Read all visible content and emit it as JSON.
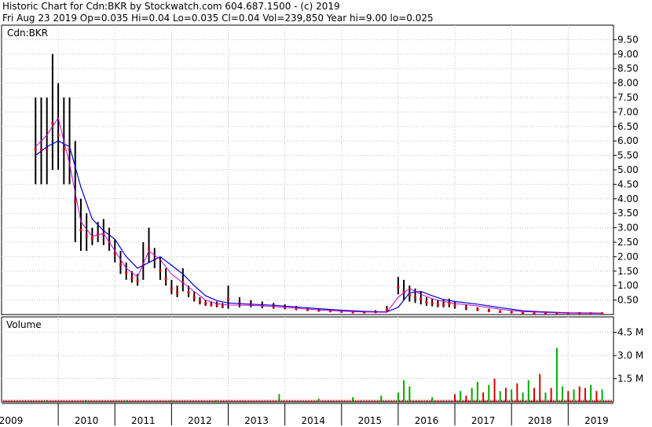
{
  "header": {
    "line1": "Historic Chart for Cdn:BKR by Stockwatch.com 604.687.1500 - (c) 2019",
    "line2": "Fri Aug 23 2019  Op=0.035  Hi=0.04  Lo=0.035  Cl=0.04  Vol=239,850  Year hi=9.00  lo=0.025"
  },
  "colors": {
    "background": "#ffffff",
    "grid": "#c0c0c0",
    "price_bar": "#000000",
    "ma_fast": "#cc00cc",
    "ma_slow": "#0000cc",
    "close_dots": "#dd0000",
    "volume_up": "#00aa00",
    "volume_down": "#dd0000"
  },
  "chart_data": [
    {
      "type": "line",
      "title": "Cdn:BKR",
      "ylim": [
        0,
        10
      ],
      "y_ticks": [
        "9.50",
        "9.00",
        "8.50",
        "8.00",
        "7.50",
        "7.00",
        "6.50",
        "6.00",
        "5.50",
        "5.00",
        "4.50",
        "4.00",
        "3.50",
        "3.00",
        "2.50",
        "2.00",
        "1.50",
        "1.00",
        "0.50"
      ],
      "x_ticks": [
        "2009",
        "2010",
        "2011",
        "2012",
        "2013",
        "2014",
        "2015",
        "2016",
        "2017",
        "2018",
        "2019"
      ],
      "grid": true,
      "series": [
        {
          "style": "hi-lo bars",
          "x": [
            2009.6,
            2009.7,
            2009.8,
            2009.9,
            2010.0,
            2010.1,
            2010.2,
            2010.3,
            2010.4,
            2010.5,
            2010.6,
            2010.7,
            2010.8,
            2010.9,
            2011.0,
            2011.1,
            2011.2,
            2011.3,
            2011.4,
            2011.5,
            2011.6,
            2011.7,
            2011.8,
            2011.9,
            2012.0,
            2012.1,
            2012.2,
            2012.3,
            2012.4,
            2012.5,
            2012.6,
            2012.7,
            2012.8,
            2012.9,
            2013.0,
            2013.2,
            2013.4,
            2013.6,
            2013.8,
            2014.0,
            2014.2,
            2014.4,
            2014.6,
            2014.8,
            2015.0,
            2015.2,
            2015.4,
            2015.6,
            2015.8,
            2016.0,
            2016.1,
            2016.2,
            2016.3,
            2016.4,
            2016.5,
            2016.6,
            2016.7,
            2016.8,
            2016.9,
            2017.0,
            2017.2,
            2017.4,
            2017.6,
            2017.8,
            2018.0,
            2018.2,
            2018.4,
            2018.6,
            2018.8,
            2019.0,
            2019.2,
            2019.4,
            2019.6
          ],
          "high": [
            7.5,
            7.5,
            7.5,
            9.0,
            8.0,
            7.5,
            7.5,
            6.0,
            4.0,
            3.5,
            3.0,
            3.2,
            3.3,
            3.0,
            2.6,
            2.2,
            1.8,
            1.5,
            1.4,
            2.5,
            3.0,
            2.3,
            2.0,
            1.6,
            1.2,
            1.0,
            1.6,
            1.0,
            0.8,
            0.6,
            0.5,
            0.45,
            0.45,
            0.4,
            1.0,
            0.6,
            0.5,
            0.45,
            0.4,
            0.35,
            0.3,
            0.25,
            0.2,
            0.18,
            0.15,
            0.12,
            0.12,
            0.15,
            0.3,
            1.3,
            1.2,
            1.0,
            0.9,
            0.8,
            0.6,
            0.55,
            0.5,
            0.5,
            0.55,
            0.45,
            0.35,
            0.25,
            0.2,
            0.15,
            0.12,
            0.1,
            0.08,
            0.08,
            0.07,
            0.06,
            0.06,
            0.05,
            0.04
          ],
          "low": [
            4.5,
            4.5,
            4.5,
            5.0,
            5.0,
            4.5,
            4.5,
            2.5,
            2.2,
            2.2,
            2.4,
            2.5,
            2.4,
            2.2,
            1.8,
            1.4,
            1.2,
            1.1,
            1.0,
            1.2,
            1.8,
            1.6,
            1.2,
            1.0,
            0.7,
            0.6,
            0.8,
            0.6,
            0.45,
            0.35,
            0.3,
            0.28,
            0.25,
            0.22,
            0.2,
            0.25,
            0.25,
            0.22,
            0.2,
            0.18,
            0.15,
            0.12,
            0.1,
            0.08,
            0.07,
            0.05,
            0.05,
            0.05,
            0.08,
            0.7,
            0.5,
            0.45,
            0.4,
            0.35,
            0.3,
            0.28,
            0.25,
            0.25,
            0.25,
            0.2,
            0.15,
            0.12,
            0.08,
            0.06,
            0.05,
            0.04,
            0.03,
            0.03,
            0.03,
            0.025,
            0.03,
            0.03,
            0.035
          ]
        },
        {
          "style": "moving average (fast)",
          "x": [
            2009.6,
            2009.8,
            2010.0,
            2010.2,
            2010.4,
            2010.6,
            2010.8,
            2011.0,
            2011.2,
            2011.4,
            2011.6,
            2011.8,
            2012.0,
            2012.2,
            2012.4,
            2012.6,
            2012.8,
            2013.0,
            2013.4,
            2013.8,
            2014.2,
            2014.6,
            2015.0,
            2015.4,
            2015.8,
            2016.0,
            2016.2,
            2016.4,
            2016.6,
            2016.8,
            2017.0,
            2017.4,
            2017.8,
            2018.2,
            2018.6,
            2019.0,
            2019.6
          ],
          "y": [
            5.8,
            6.2,
            6.8,
            5.2,
            3.2,
            2.7,
            2.8,
            2.2,
            1.6,
            1.3,
            2.2,
            1.9,
            1.4,
            1.1,
            0.8,
            0.5,
            0.38,
            0.33,
            0.32,
            0.28,
            0.22,
            0.16,
            0.12,
            0.09,
            0.08,
            0.6,
            0.9,
            0.7,
            0.55,
            0.45,
            0.38,
            0.3,
            0.18,
            0.1,
            0.07,
            0.05,
            0.04
          ]
        },
        {
          "style": "moving average (slow)",
          "x": [
            2009.6,
            2009.8,
            2010.0,
            2010.2,
            2010.4,
            2010.6,
            2010.8,
            2011.0,
            2011.2,
            2011.4,
            2011.6,
            2011.8,
            2012.0,
            2012.2,
            2012.4,
            2012.6,
            2012.8,
            2013.0,
            2013.4,
            2013.8,
            2014.2,
            2014.6,
            2015.0,
            2015.4,
            2015.8,
            2016.0,
            2016.2,
            2016.4,
            2016.6,
            2016.8,
            2017.0,
            2017.4,
            2017.8,
            2018.2,
            2018.6,
            2019.0,
            2019.6
          ],
          "y": [
            5.5,
            5.8,
            6.0,
            5.8,
            4.4,
            3.3,
            2.9,
            2.6,
            2.0,
            1.6,
            1.8,
            2.0,
            1.7,
            1.4,
            1.0,
            0.65,
            0.48,
            0.4,
            0.36,
            0.32,
            0.26,
            0.2,
            0.15,
            0.11,
            0.09,
            0.25,
            0.75,
            0.8,
            0.65,
            0.52,
            0.45,
            0.36,
            0.24,
            0.13,
            0.09,
            0.06,
            0.045
          ]
        }
      ]
    },
    {
      "type": "bar",
      "title": "Volume",
      "ylim": [
        0,
        5.5
      ],
      "y_ticks": [
        "4.5 M",
        "3.0 M",
        "1.5 M"
      ],
      "series": [
        {
          "name": "",
          "x": [
            2009.8,
            2010.5,
            2011.2,
            2012.0,
            2012.8,
            2013.9,
            2014.6,
            2015.2,
            2015.7,
            2016.0,
            2016.1,
            2016.2,
            2016.6,
            2017.0,
            2017.1,
            2017.2,
            2017.3,
            2017.4,
            2017.5,
            2017.6,
            2017.7,
            2017.8,
            2017.9,
            2018.0,
            2018.1,
            2018.2,
            2018.3,
            2018.4,
            2018.5,
            2018.6,
            2018.7,
            2018.8,
            2018.9,
            2019.0,
            2019.1,
            2019.2,
            2019.3,
            2019.4,
            2019.5,
            2019.6
          ],
          "values": [
            0.1,
            0.1,
            0.1,
            0.1,
            0.1,
            0.5,
            0.2,
            0.3,
            0.4,
            0.6,
            1.4,
            1.0,
            0.3,
            0.5,
            0.7,
            0.4,
            0.9,
            1.3,
            0.6,
            1.1,
            1.5,
            0.7,
            0.9,
            0.8,
            1.2,
            0.6,
            1.4,
            0.9,
            1.8,
            0.6,
            0.9,
            3.5,
            1.0,
            0.7,
            0.8,
            1.0,
            0.9,
            1.1,
            0.7,
            0.8
          ],
          "up": [
            true,
            true,
            true,
            true,
            true,
            true,
            true,
            true,
            true,
            true,
            true,
            true,
            true,
            false,
            true,
            false,
            true,
            true,
            false,
            true,
            false,
            true,
            false,
            true,
            false,
            true,
            true,
            false,
            false,
            true,
            false,
            true,
            true,
            false,
            true,
            false,
            false,
            true,
            false,
            true
          ]
        }
      ]
    }
  ]
}
